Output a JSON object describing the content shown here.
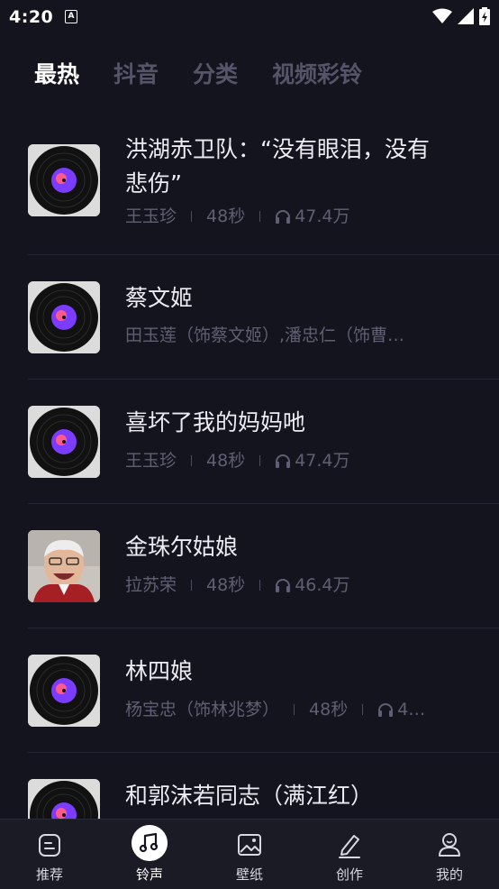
{
  "status": {
    "time": "4:20",
    "app_icon_letter": "A"
  },
  "tabs": [
    {
      "label": "最热",
      "active": true
    },
    {
      "label": "抖音"
    },
    {
      "label": "分类"
    },
    {
      "label": "视频彩铃"
    }
  ],
  "items": [
    {
      "title": "洪湖赤卫队：“没有眼泪，没有悲伤”",
      "artist": "王玉珍",
      "duration": "48秒",
      "plays": "47.4万",
      "cover": "vinyl-disc"
    },
    {
      "title": "蔡文姬",
      "artist": "田玉莲（饰蔡文姬）,潘忠仁（饰曹…",
      "cover": "vinyl-disc"
    },
    {
      "title": "喜坏了我的妈妈吔",
      "artist": "王玉珍",
      "duration": "48秒",
      "plays": "47.4万",
      "cover": "vinyl-disc"
    },
    {
      "title": "金珠尔姑娘",
      "artist": "拉苏荣",
      "duration": "48秒",
      "plays": "46.4万",
      "cover": "artist-photo"
    },
    {
      "title": "林四娘",
      "artist": "杨宝忠（饰林兆梦）",
      "duration": "48秒",
      "plays": "4…",
      "cover": "vinyl-disc"
    },
    {
      "title": "和郭沫若同志（满江红）",
      "cover": "vinyl-disc"
    }
  ],
  "nav": [
    {
      "label": "推荐",
      "icon": "home-icon"
    },
    {
      "label": "铃声",
      "icon": "music-note-icon",
      "active": true
    },
    {
      "label": "壁纸",
      "icon": "image-icon"
    },
    {
      "label": "创作",
      "icon": "pencil-icon"
    },
    {
      "label": "我的",
      "icon": "profile-icon"
    }
  ],
  "colors": {
    "background": "#14141e",
    "active_tab": "#ffffff",
    "inactive_tab": "#55556a",
    "meta_text": "#5f5f73",
    "disc_center": "#7b3cff"
  }
}
